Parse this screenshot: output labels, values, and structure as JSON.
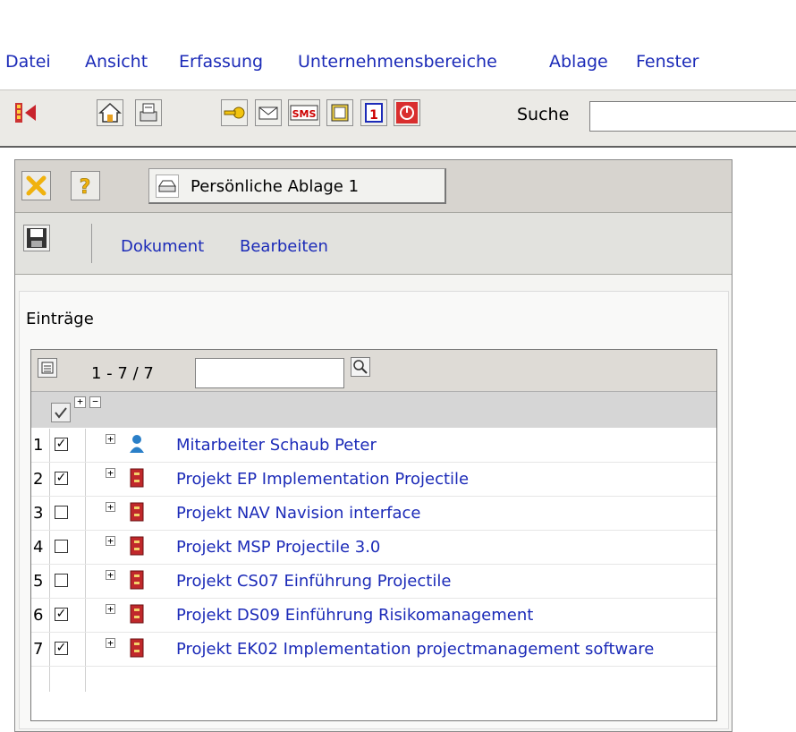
{
  "menu": [
    "Datei",
    "Ansicht",
    "Erfassung",
    "Unternehmensbereiche",
    "Ablage",
    "Fenster"
  ],
  "toolbar": {
    "search_label": "Suche",
    "search_value": ""
  },
  "window": {
    "tab_label": "Persönliche Ablage 1",
    "commands": [
      "Dokument",
      "Bearbeiten"
    ]
  },
  "entries": {
    "title": "Einträge",
    "count": "1 - 7 / 7",
    "filter_value": "",
    "rows": [
      {
        "num": "1",
        "checked": true,
        "type": "person",
        "label": "Mitarbeiter Schaub Peter"
      },
      {
        "num": "2",
        "checked": true,
        "type": "project",
        "label": "Projekt EP Implementation Projectile"
      },
      {
        "num": "3",
        "checked": false,
        "type": "project",
        "label": "Projekt NAV Navision interface"
      },
      {
        "num": "4",
        "checked": false,
        "type": "project",
        "label": "Projekt MSP Projectile 3.0"
      },
      {
        "num": "5",
        "checked": false,
        "type": "project",
        "label": "Projekt CS07 Einführung Projectile"
      },
      {
        "num": "6",
        "checked": true,
        "type": "project",
        "label": "Projekt DS09 Einführung Risikomanagement"
      },
      {
        "num": "7",
        "checked": true,
        "type": "project",
        "label": "Projekt EK02 Implementation projectmanagement software"
      }
    ]
  },
  "colors": {
    "link": "#1c2bb8",
    "project_icon": "#c0282b",
    "person_icon": "#2a7fc8"
  }
}
